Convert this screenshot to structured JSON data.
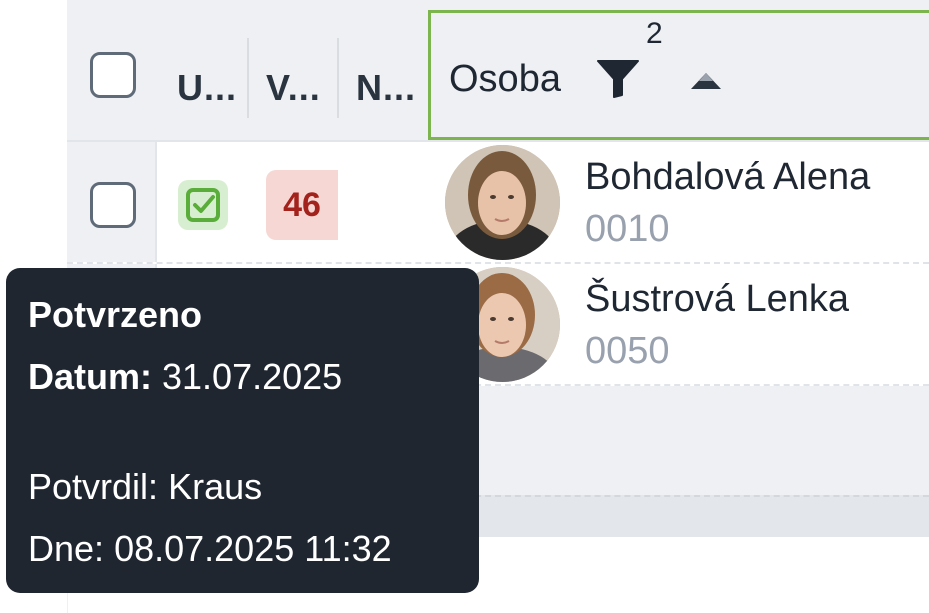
{
  "header": {
    "columns": [
      {
        "label": "U..."
      },
      {
        "label": "V..."
      },
      {
        "label": "N..."
      }
    ],
    "osoba": {
      "label": "Osoba",
      "filter_count": "2"
    }
  },
  "rows": [
    {
      "badge": "46",
      "name": "Bohdalová Alena",
      "id": "0010"
    },
    {
      "name": "Šustrová Lenka",
      "id": "0050"
    }
  ],
  "tooltip": {
    "title": "Potvrzeno",
    "date_label": "Datum:",
    "date_value": "31.07.2025",
    "by_label": "Potvrdil:",
    "by_value": "Kraus",
    "when_label": "Dne:",
    "when_value": "08.07.2025 11:32"
  },
  "colors": {
    "accent_green": "#7cb44e",
    "badge_bg": "#f6d7d4",
    "badge_text": "#a3221c",
    "tooltip_bg": "#1f2630"
  },
  "icons": [
    "checkbox-icon",
    "check-confirmed-icon",
    "filter-icon",
    "sort-asc-icon",
    "avatar"
  ]
}
